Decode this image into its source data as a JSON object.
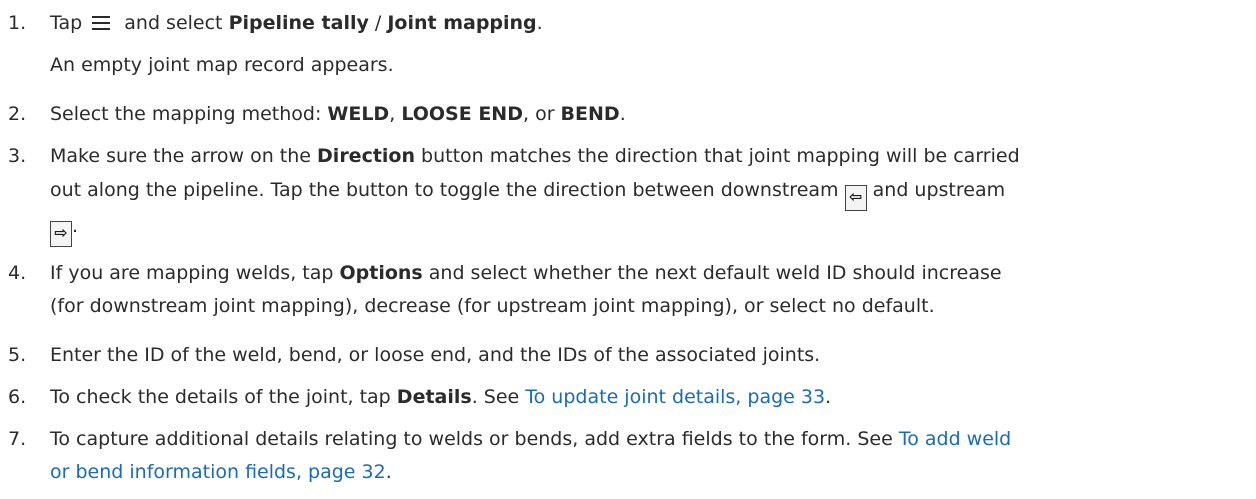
{
  "steps": [
    {
      "num": "1.",
      "pre": "Tap",
      "icon": "menu-icon",
      "mid": "and select",
      "bold1": "Pipeline tally",
      "sep": " / ",
      "bold2": "Joint mapping",
      "end": ".",
      "note": "An empty joint map record appears."
    },
    {
      "num": "2.",
      "pre": "Select the mapping method: ",
      "bold1": "WELD",
      "sep1": ", ",
      "bold2": "LOOSE END",
      "sep2": ", or ",
      "bold3": "BEND",
      "end": "."
    },
    {
      "num": "3.",
      "line1_pre": "Make sure the arrow on the ",
      "line1_bold": "Direction",
      "line1_post": " button matches the direction that joint mapping will be carried",
      "line2_pre": "out along the pipeline. Tap the button to toggle the direction between downstream ",
      "btn_down": "⇦",
      "line2_mid": " and upstream",
      "btn_up": "⇨",
      "line3_end": "."
    },
    {
      "num": "4.",
      "line1_pre": "If you are mapping welds, tap ",
      "line1_bold": "Options",
      "line1_post": " and select whether the next default weld ID should increase",
      "line2": "(for downstream joint mapping), decrease (for upstream joint mapping), or select no default."
    },
    {
      "num": "5.",
      "text": "Enter the ID of the weld, bend, or loose end, and the IDs of the associated joints."
    },
    {
      "num": "6.",
      "pre": "To check the details of the joint, tap ",
      "bold": "Details",
      "mid": ". See ",
      "link": "To update joint details, page 33",
      "end": "."
    },
    {
      "num": "7.",
      "line1_pre": "To capture additional details relating to welds or bends, add extra fields to the form. See ",
      "line1_link": "To add weld",
      "line2_link": "or bend information fields, page 32",
      "line2_end": "."
    }
  ],
  "colors": {
    "text": "#2b2b2b",
    "link": "#1a6bb5"
  }
}
